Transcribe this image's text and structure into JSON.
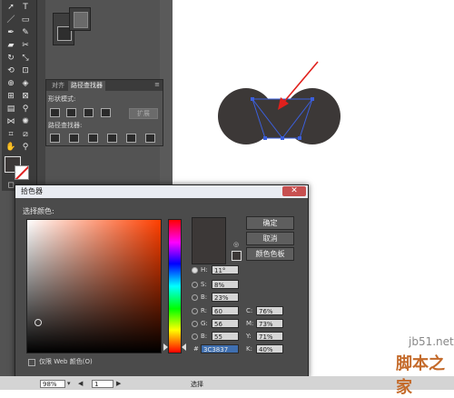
{
  "pathfinder": {
    "tabs": [
      "对齐",
      "路径查找器"
    ],
    "shape_modes_label": "形状模式:",
    "pathfinders_label": "路径查找器:",
    "expand_label": "扩展"
  },
  "color_picker": {
    "title": "拾色器",
    "select_color_label": "选择颜色:",
    "buttons": {
      "ok": "确定",
      "cancel": "取消",
      "swatches": "颜色色板"
    },
    "hsb": [
      {
        "label": "H:",
        "value": "11°"
      },
      {
        "label": "S:",
        "value": "8%"
      },
      {
        "label": "B:",
        "value": "23%"
      }
    ],
    "rgb": [
      {
        "label": "R:",
        "value": "60"
      },
      {
        "label": "G:",
        "value": "56"
      },
      {
        "label": "B:",
        "value": "55"
      }
    ],
    "cmyk": [
      {
        "label": "C:",
        "value": "76%"
      },
      {
        "label": "M:",
        "value": "73%"
      },
      {
        "label": "Y:",
        "value": "71%"
      },
      {
        "label": "K:",
        "value": "40%"
      }
    ],
    "hex_label": "#",
    "hex_value": "3C3837",
    "web_only_label": "仅限 Web 颜色(O)",
    "current_color": "#3c3837"
  },
  "statusbar": {
    "zoom": "98%",
    "page": "1",
    "mode": "选择"
  },
  "watermark": {
    "url": "jb51.net",
    "name": "脚本之家"
  },
  "colors": {
    "shape_fill": "#3c3837",
    "selection": "#3b5fdc",
    "arrow": "#e0201c"
  }
}
